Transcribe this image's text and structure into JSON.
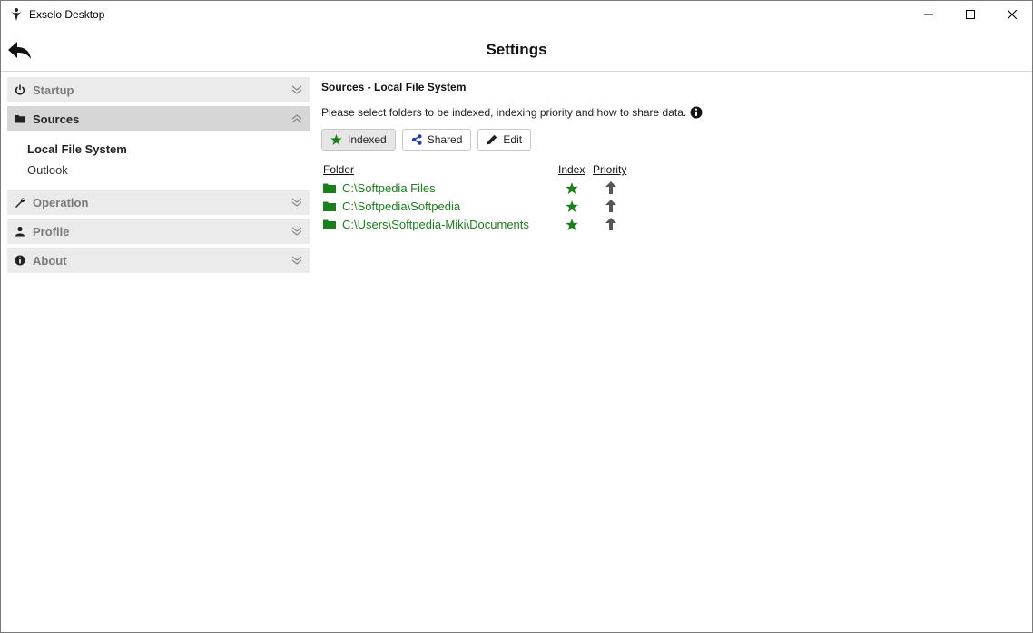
{
  "window": {
    "title": "Exselo Desktop"
  },
  "header": {
    "title": "Settings"
  },
  "sidebar": {
    "sections": [
      {
        "label": "Startup",
        "icon": "power-icon"
      },
      {
        "label": "Sources",
        "icon": "folder-icon",
        "expanded": true,
        "items": [
          "Local File System",
          "Outlook"
        ],
        "selected_item": "Local File System"
      },
      {
        "label": "Operation",
        "icon": "wrench-icon"
      },
      {
        "label": "Profile",
        "icon": "user-icon"
      },
      {
        "label": "About",
        "icon": "info-icon"
      }
    ]
  },
  "main": {
    "section_title": "Sources - Local File System",
    "description": "Please select folders to be indexed, indexing priority and how to share data.",
    "buttons": [
      {
        "label": "Indexed",
        "icon": "star-icon",
        "active": true
      },
      {
        "label": "Shared",
        "icon": "share-icon"
      },
      {
        "label": "Edit",
        "icon": "pencil-icon"
      }
    ],
    "table": {
      "headers": {
        "folder": "Folder",
        "index": "Index",
        "priority": "Priority"
      },
      "rows": [
        {
          "path": "C:\\Softpedia Files"
        },
        {
          "path": "C:\\Softpedia\\Softpedia"
        },
        {
          "path": "C:\\Users\\Softpedia-Miki\\Documents"
        }
      ]
    }
  },
  "colors": {
    "accent_green": "#1b7f1b",
    "share_blue": "#1a3fb0",
    "sidebar_bg": "#ebebeb",
    "sidebar_active_bg": "#d6d6d6"
  }
}
